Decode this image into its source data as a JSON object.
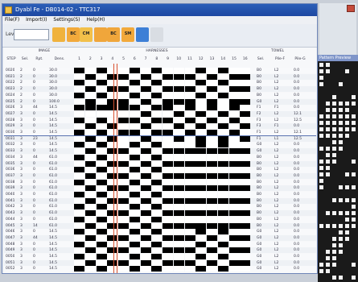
{
  "window": {
    "title": "Dyabl Fe  -  DB014-02  -  TTC317"
  },
  "menu": [
    "File(F)",
    "Import(I)",
    "Settings(S)",
    "Help(H)"
  ],
  "toolbar": {
    "field_label": "Lev"
  },
  "toolbar_buttons": [
    {
      "name": "open-icon",
      "text": "",
      "color": "#f0b23d"
    },
    {
      "name": "badge-bc-icon",
      "text": "BC",
      "color": "#f2a93b"
    },
    {
      "name": "badge-cm-icon",
      "text": "CM",
      "color": "#f2c04a"
    },
    {
      "name": "folder-up-icon",
      "text": "",
      "color": "#f0a63b"
    },
    {
      "name": "badge-bc-2-icon",
      "text": "BC",
      "color": "#f0a63b"
    },
    {
      "name": "badge-sm-icon",
      "text": "SM",
      "color": "#f2a93b"
    },
    {
      "name": "window-icon",
      "text": "",
      "color": "#3d7fd6"
    },
    {
      "name": "search-icon",
      "text": "",
      "color": "#d9dde3"
    }
  ],
  "headers": {
    "group_image": "IMAGE",
    "group_harnesses": "HARNESSES",
    "group_towel": "TOWEL",
    "step": "STEP",
    "sel": "Sel.",
    "rpt": "Rpt.",
    "dens": "Dens.",
    "towel_sel": "Sel.",
    "towel_pile": "Pile-F",
    "towel_pile2": "Pile-G",
    "harness_numbers": [
      "1",
      "2",
      "3",
      "4",
      "5",
      "6",
      "7",
      "8",
      "9",
      "10",
      "11",
      "12",
      "13",
      "14",
      "15",
      "16"
    ]
  },
  "rows": [
    {
      "step": "0020",
      "sel": "2",
      "rpt": "0",
      "dens": "30.0",
      "tsel": "B0",
      "pile": "L2",
      "pile2": "0.0"
    },
    {
      "step": "0021",
      "sel": "2",
      "rpt": "0",
      "dens": "30.0",
      "tsel": "B0",
      "pile": "L2",
      "pile2": "0.0"
    },
    {
      "step": "0022",
      "sel": "2",
      "rpt": "0",
      "dens": "30.0",
      "tsel": "B0",
      "pile": "L2",
      "pile2": "0.0"
    },
    {
      "step": "0023",
      "sel": "2",
      "rpt": "0",
      "dens": "30.0",
      "tsel": "B0",
      "pile": "L2",
      "pile2": "0.0"
    },
    {
      "step": "0024",
      "sel": "2",
      "rpt": "0",
      "dens": "30.0",
      "tsel": "B0",
      "pile": "L2",
      "pile2": "0.0"
    },
    {
      "step": "0025",
      "sel": "2",
      "rpt": "0",
      "dens": "100.0",
      "tsel": "G0",
      "pile": "L2",
      "pile2": "0.0"
    },
    {
      "step": "0026",
      "sel": "3",
      "rpt": "44",
      "dens": "14.5",
      "tsel": "F1",
      "pile": "F1",
      "pile2": "0.0"
    },
    {
      "step": "0027",
      "sel": "3",
      "rpt": "0",
      "dens": "14.5",
      "tsel": "F2",
      "pile": "L2",
      "pile2": "12.1"
    },
    {
      "step": "0028",
      "sel": "3",
      "rpt": "0",
      "dens": "14.5",
      "tsel": "F3",
      "pile": "L2",
      "pile2": "12.5"
    },
    {
      "step": "0029",
      "sel": "3",
      "rpt": "0",
      "dens": "14.5",
      "tsel": "F3",
      "pile": "F1",
      "pile2": "0.0"
    },
    {
      "step": "0030",
      "sel": "3",
      "rpt": "0",
      "dens": "14.5",
      "tsel": "F1",
      "pile": "L2",
      "pile2": "12.1"
    },
    {
      "step": "0031",
      "sel": "3",
      "rpt": "23",
      "dens": "14.5",
      "tsel": "F1",
      "pile": "L1",
      "pile2": "12.5"
    },
    {
      "step": "0032",
      "sel": "3",
      "rpt": "0",
      "dens": "14.5",
      "tsel": "G0",
      "pile": "L2",
      "pile2": "0.0"
    },
    {
      "step": "0033",
      "sel": "3",
      "rpt": "0",
      "dens": "14.5",
      "tsel": "G0",
      "pile": "L2",
      "pile2": "0.0"
    },
    {
      "step": "0034",
      "sel": "3",
      "rpt": "44",
      "dens": "61.0",
      "tsel": "B0",
      "pile": "L2",
      "pile2": "0.0"
    },
    {
      "step": "0035",
      "sel": "3",
      "rpt": "0",
      "dens": "61.0",
      "tsel": "B0",
      "pile": "L2",
      "pile2": "0.0"
    },
    {
      "step": "0036",
      "sel": "3",
      "rpt": "0",
      "dens": "61.0",
      "tsel": "B0",
      "pile": "L2",
      "pile2": "0.0"
    },
    {
      "step": "0037",
      "sel": "3",
      "rpt": "0",
      "dens": "61.0",
      "tsel": "B0",
      "pile": "L2",
      "pile2": "0.0"
    },
    {
      "step": "0038",
      "sel": "3",
      "rpt": "0",
      "dens": "61.0",
      "tsel": "B0",
      "pile": "L2",
      "pile2": "0.0"
    },
    {
      "step": "0039",
      "sel": "3",
      "rpt": "0",
      "dens": "61.0",
      "tsel": "B0",
      "pile": "L2",
      "pile2": "0.0"
    },
    {
      "step": "0040",
      "sel": "3",
      "rpt": "0",
      "dens": "61.0",
      "tsel": "B0",
      "pile": "L2",
      "pile2": "0.0"
    },
    {
      "step": "0041",
      "sel": "3",
      "rpt": "0",
      "dens": "61.0",
      "tsel": "B0",
      "pile": "L2",
      "pile2": "0.0"
    },
    {
      "step": "0042",
      "sel": "3",
      "rpt": "0",
      "dens": "61.0",
      "tsel": "B0",
      "pile": "L2",
      "pile2": "0.0"
    },
    {
      "step": "0043",
      "sel": "3",
      "rpt": "0",
      "dens": "61.0",
      "tsel": "B0",
      "pile": "L2",
      "pile2": "0.0"
    },
    {
      "step": "0044",
      "sel": "3",
      "rpt": "0",
      "dens": "61.0",
      "tsel": "B0",
      "pile": "L2",
      "pile2": "0.0"
    },
    {
      "step": "0045",
      "sel": "3",
      "rpt": "14",
      "dens": "61.0",
      "tsel": "B0",
      "pile": "L2",
      "pile2": "0.0"
    },
    {
      "step": "0046",
      "sel": "3",
      "rpt": "0",
      "dens": "14.5",
      "tsel": "G0",
      "pile": "L2",
      "pile2": "0.0"
    },
    {
      "step": "0047",
      "sel": "3",
      "rpt": "44",
      "dens": "14.5",
      "tsel": "G0",
      "pile": "L2",
      "pile2": "0.0"
    },
    {
      "step": "0048",
      "sel": "3",
      "rpt": "0",
      "dens": "14.5",
      "tsel": "G0",
      "pile": "L2",
      "pile2": "0.0"
    },
    {
      "step": "0049",
      "sel": "3",
      "rpt": "0",
      "dens": "14.5",
      "tsel": "G0",
      "pile": "L2",
      "pile2": "0.0"
    },
    {
      "step": "0050",
      "sel": "3",
      "rpt": "0",
      "dens": "14.5",
      "tsel": "G0",
      "pile": "L2",
      "pile2": "0.0"
    },
    {
      "step": "0051",
      "sel": "3",
      "rpt": "0",
      "dens": "14.5",
      "tsel": "G0",
      "pile": "L2",
      "pile2": "0.0"
    },
    {
      "step": "0052",
      "sel": "3",
      "rpt": "0",
      "dens": "14.5",
      "tsel": "G0",
      "pile": "L2",
      "pile2": "0.0"
    }
  ],
  "pattern": [
    "1010010100010100",
    "0101101011101011",
    "1010010100010100",
    "0101101011101011",
    "1010010100010100",
    "0101101011101011",
    "1111110110101010",
    "0000001001010101",
    "1010110110101010",
    "0101001001010101",
    "1010110110101010",
    "0101001001010101",
    "1010010100010100",
    "0101101011111111",
    "1010010100000000",
    "0101101011111111",
    "1010010100000000",
    "0101101011111111",
    "1010010100000000",
    "0101101011111111",
    "1010010100000000",
    "0101101011111111",
    "1010010100000000",
    "0101101011111111",
    "1010010100000000",
    "0101101011111111",
    "1010010100010100",
    "0101101011101011",
    "1010010100010100",
    "0101101011101011",
    "1010010100010100",
    "0101101011101011",
    "1010010100010100"
  ],
  "side_panel": {
    "caption": "Pattern Preview"
  }
}
